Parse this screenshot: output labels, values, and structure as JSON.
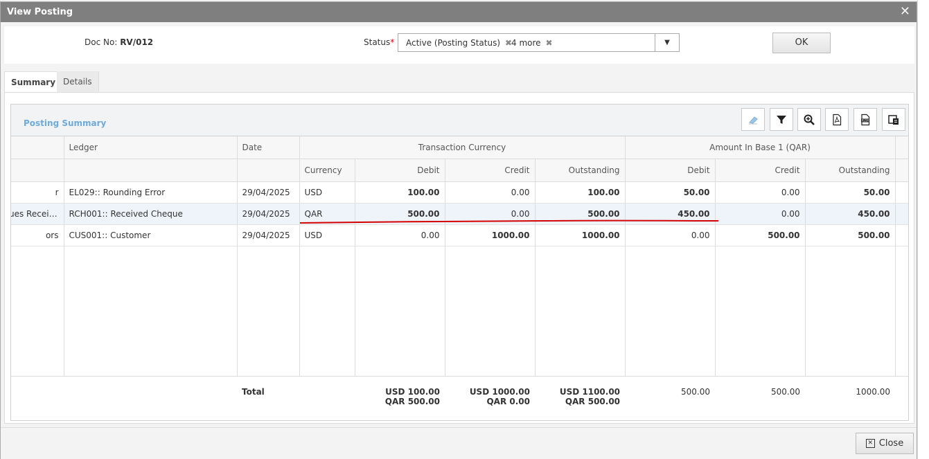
{
  "dialog": {
    "title": "View Posting",
    "close_label": "Close"
  },
  "header": {
    "doc_label": "Doc No:",
    "doc_value": "RV/012",
    "status_label": "Status",
    "status_required": "*",
    "status_chips": [
      "Active (Posting Status)",
      "4 more"
    ],
    "ok_label": "OK"
  },
  "tabs": [
    {
      "label": "Summary",
      "active": true
    },
    {
      "label": "Details",
      "active": false
    }
  ],
  "grid": {
    "title": "Posting Summary",
    "toolbar": [
      "eraser-icon",
      "filter-icon",
      "zoom-icon",
      "pdf-icon",
      "xlsx-icon",
      "columns-icon"
    ],
    "group_headers": {
      "transaction": "Transaction Currency",
      "base": "Amount In Base 1 (QAR)"
    },
    "columns": {
      "ledger": "Ledger",
      "date": "Date",
      "currency": "Currency",
      "debit": "Debit",
      "credit": "Credit",
      "outstanding": "Outstanding"
    },
    "rows": [
      {
        "account": "r",
        "ledger": "EL029:: Rounding Error",
        "date": "29/04/2025",
        "currency": "USD",
        "t_debit": "100.00",
        "t_credit": "0.00",
        "t_out": "100.00",
        "b_debit": "50.00",
        "b_credit": "0.00",
        "b_out": "50.00"
      },
      {
        "account": "ues Receiv...",
        "ledger": "RCH001:: Received Cheque",
        "date": "29/04/2025",
        "currency": "QAR",
        "t_debit": "500.00",
        "t_credit": "0.00",
        "t_out": "500.00",
        "b_debit": "450.00",
        "b_credit": "0.00",
        "b_out": "450.00"
      },
      {
        "account": "ors",
        "ledger": "CUS001:: Customer",
        "date": "29/04/2025",
        "currency": "USD",
        "t_debit": "0.00",
        "t_credit": "1000.00",
        "t_out": "1000.00",
        "b_debit": "0.00",
        "b_credit": "500.00",
        "b_out": "500.00"
      }
    ],
    "total": {
      "label": "Total",
      "t_debit": [
        "USD 100.00",
        "QAR 500.00"
      ],
      "t_credit": [
        "USD 1000.00",
        "QAR 0.00"
      ],
      "t_out": [
        "USD 1100.00",
        "QAR 500.00"
      ],
      "b_debit": "500.00",
      "b_credit": "500.00",
      "b_out": "1000.00"
    }
  },
  "colors": {
    "accent": "#6faad8",
    "annotation": "#d40000",
    "titlebar": "#7f7f7f"
  }
}
